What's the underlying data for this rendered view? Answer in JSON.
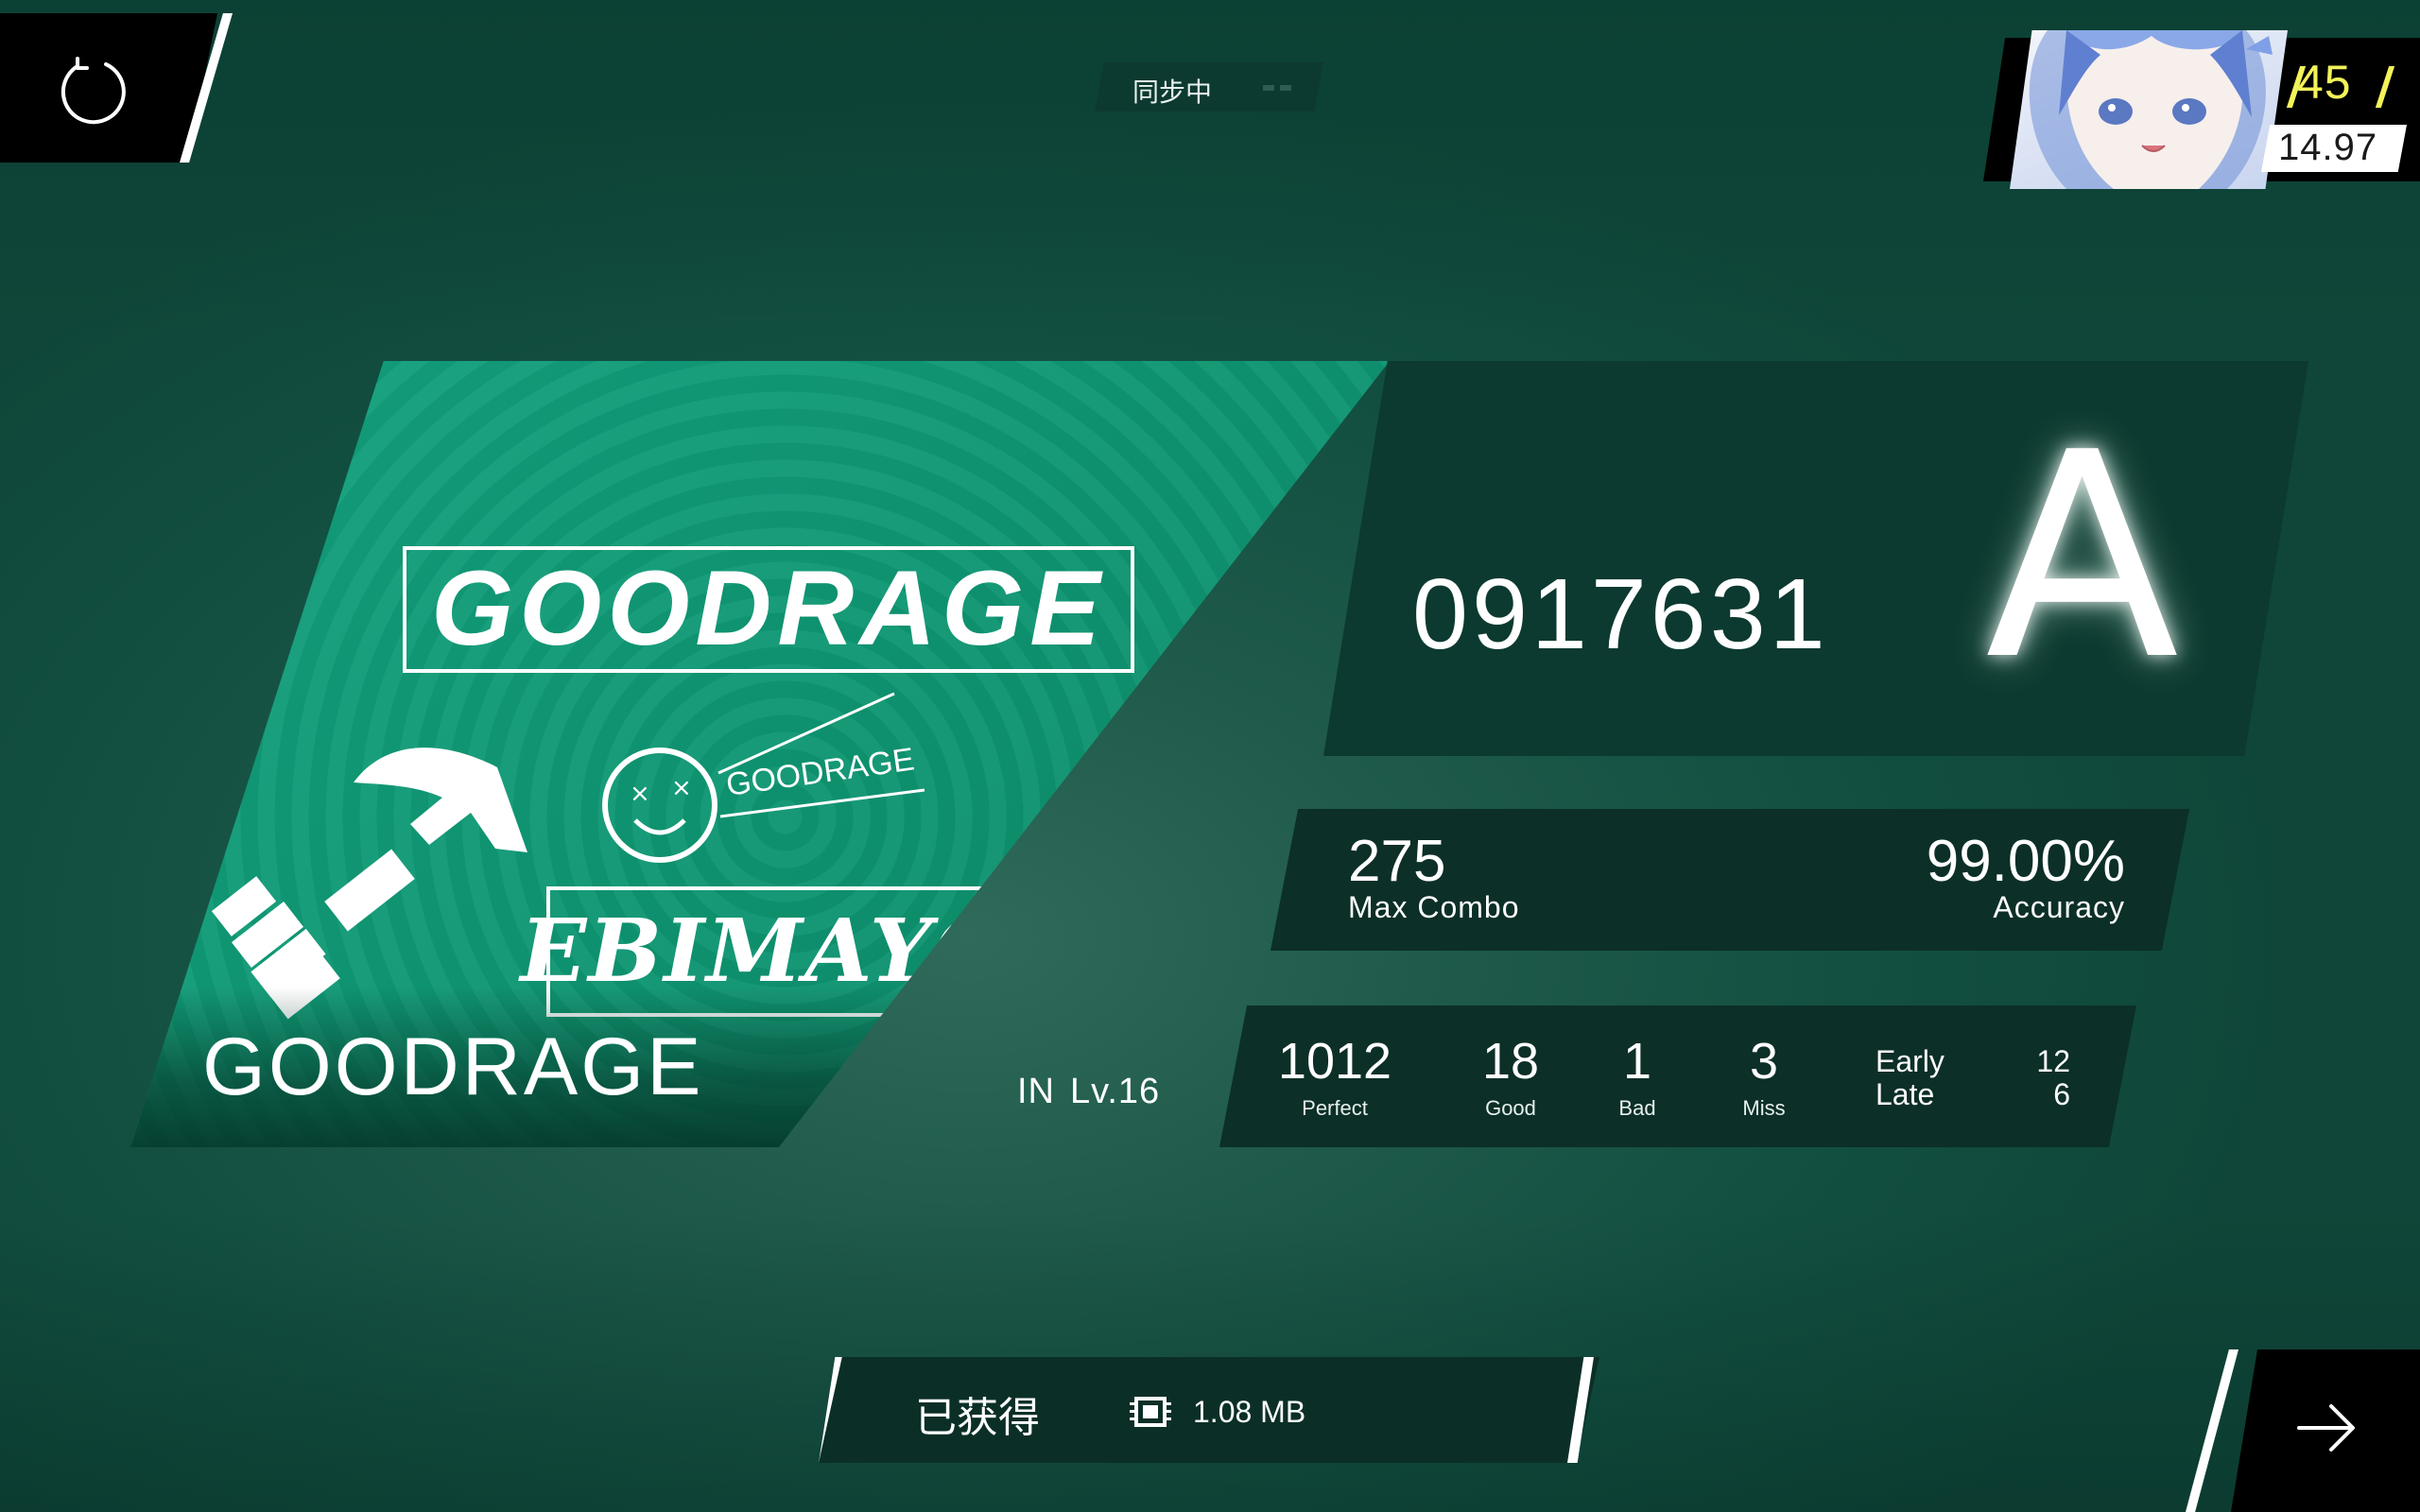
{
  "header": {
    "back_icon": "refresh-icon",
    "sync_status": "同步中"
  },
  "player": {
    "avatar_icon": "player-avatar",
    "level": "45",
    "rks": "14.97",
    "accent": "#f2f25a"
  },
  "song": {
    "title": "GOODRAGE",
    "difficulty": "IN",
    "level": "Lv.16",
    "jacket": {
      "logo_text": "GOODRAGE",
      "small_text": "GOODRAGE",
      "artist_logo": "EBIMAYO"
    }
  },
  "result": {
    "score": "0917631",
    "grade": "A",
    "max_combo": "275",
    "max_combo_label": "Max Combo",
    "accuracy": "99.00%",
    "accuracy_label": "Accuracy",
    "judgements": [
      {
        "label": "Perfect",
        "value": "1012"
      },
      {
        "label": "Good",
        "value": "18"
      },
      {
        "label": "Bad",
        "value": "1"
      },
      {
        "label": "Miss",
        "value": "3"
      }
    ],
    "early_label": "Early",
    "late_label": "Late",
    "early": "12",
    "late": "6"
  },
  "footer": {
    "acquired_label": "已获得",
    "data_icon": "data-chip-icon",
    "data_amount": "1.08 MB",
    "next_icon": "arrow-right-icon"
  },
  "colors": {
    "background": "#124f41",
    "card": "#14a27e",
    "panel": "#0c3a30"
  }
}
